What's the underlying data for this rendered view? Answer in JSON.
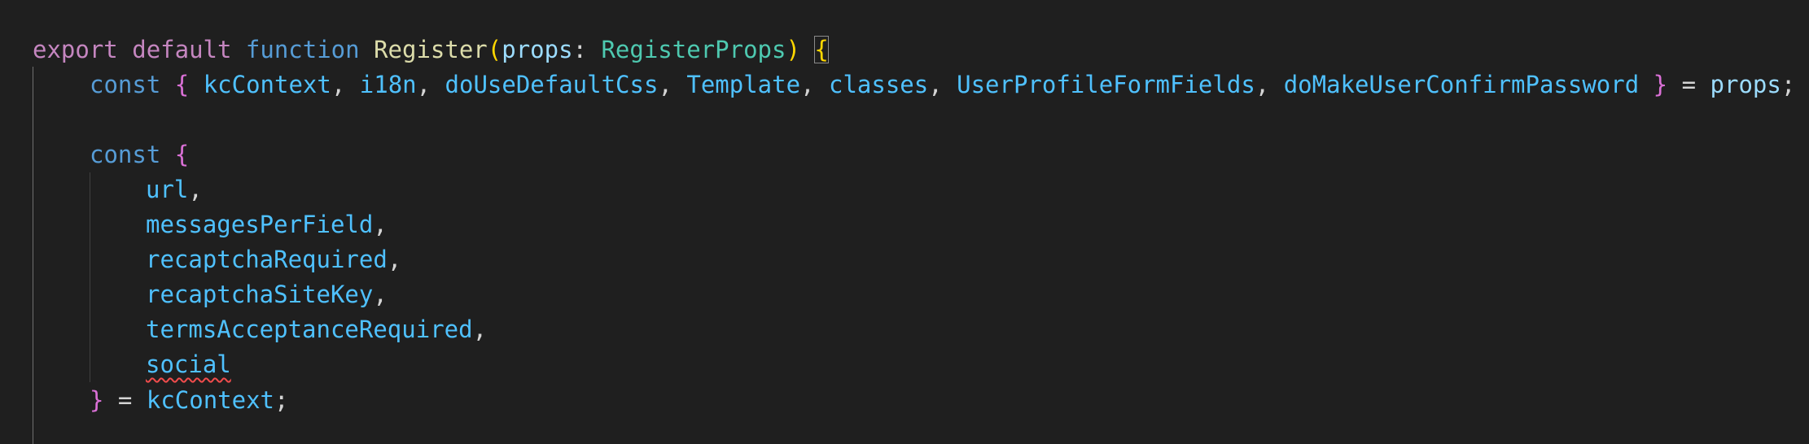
{
  "code": {
    "line1": {
      "export": "export",
      "default": "default",
      "function": "function",
      "name": "Register",
      "open_paren": "(",
      "param": "props",
      "colon": ": ",
      "type": "RegisterProps",
      "close_paren": ")",
      "open_brace": "{"
    },
    "line2": {
      "const": "const",
      "open_brace": "{",
      "items": [
        "kcContext",
        "i18n",
        "doUseDefaultCss",
        "Template",
        "classes",
        "UserProfileFormFields",
        "doMakeUserConfirmPassword"
      ],
      "close_brace": "}",
      "equals": " = ",
      "source": "props",
      "semicolon": ";"
    },
    "line4": {
      "const": "const",
      "open_brace": "{"
    },
    "destructured": [
      "url",
      "messagesPerField",
      "recaptchaRequired",
      "recaptchaSiteKey",
      "termsAcceptanceRequired",
      "social"
    ],
    "line11": {
      "close_brace": "}",
      "equals": " = ",
      "source": "kcContext",
      "semicolon": ";"
    }
  },
  "colors": {
    "background": "#1f1f1f",
    "keyword": "#569cd6",
    "control_keyword": "#c586c0",
    "function": "#dcdcaa",
    "type": "#4ec9b0",
    "variable": "#9cdcfe",
    "error_squiggle": "#f14c4c"
  }
}
